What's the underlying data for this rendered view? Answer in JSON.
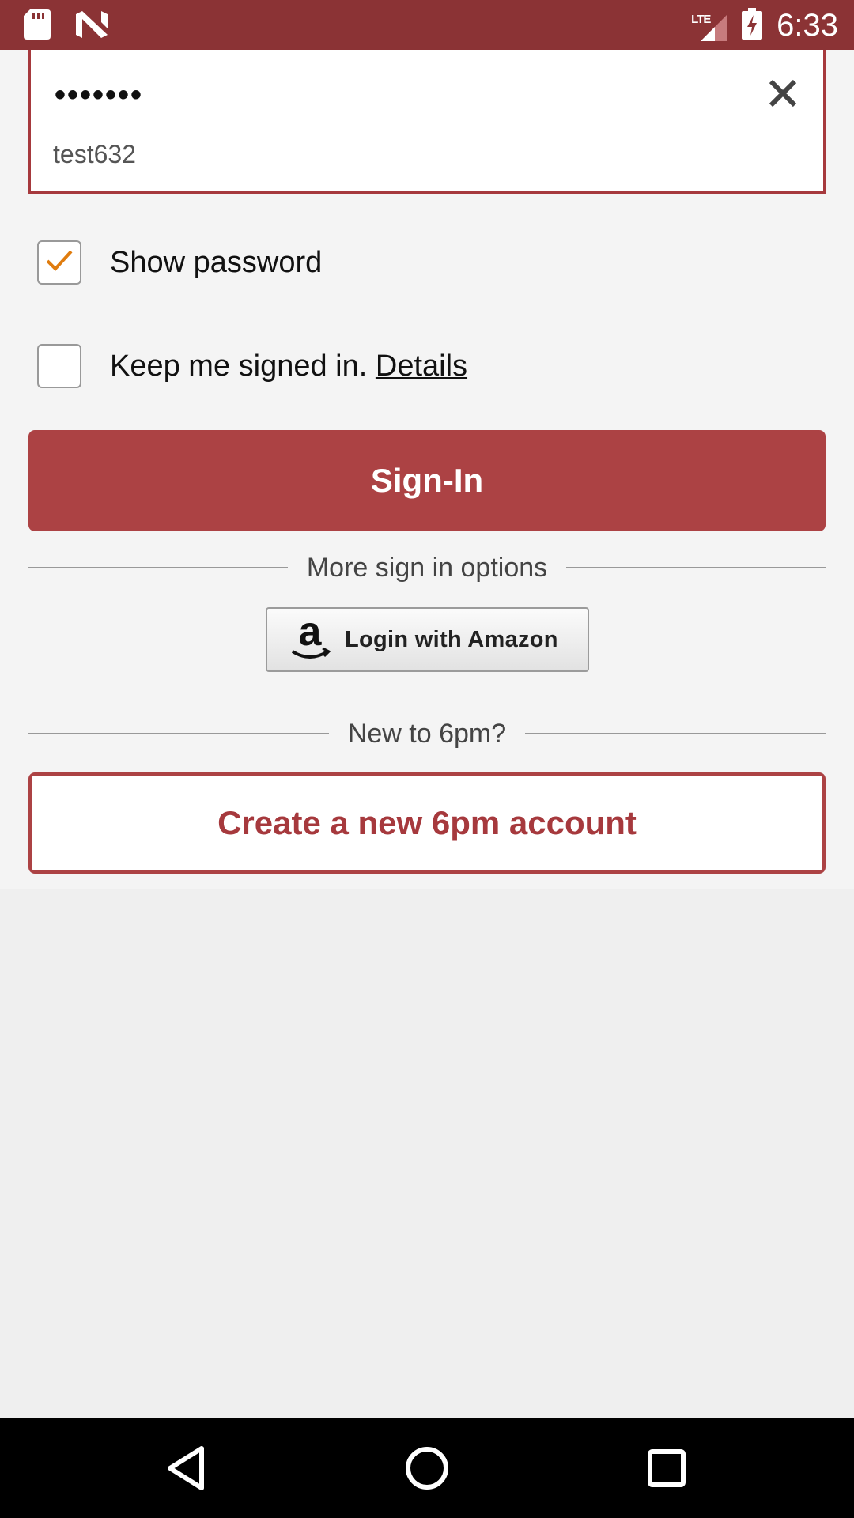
{
  "status_bar": {
    "time": "6:33",
    "network": "LTE",
    "icons": [
      "sd-card-icon",
      "n-logo-icon",
      "lte-signal-icon",
      "battery-charging-icon"
    ]
  },
  "login": {
    "password_mask": "•••••••",
    "username_suggestion": "test632",
    "show_password_label": "Show password",
    "show_password_checked": true,
    "keep_signed_in_label": "Keep me signed in.",
    "details_link": "Details",
    "keep_signed_in_checked": false,
    "signin_button": "Sign-In",
    "more_options_text": "More sign in options",
    "amazon_button": "Login with Amazon",
    "new_user_text": "New to 6pm?",
    "create_account_button": "Create a new 6pm account"
  },
  "nav": {
    "icons": [
      "back-icon",
      "home-icon",
      "recents-icon"
    ]
  },
  "colors": {
    "status_bar": "#8b3335",
    "accent": "#ac4244",
    "checkmark": "#e07c0e"
  }
}
